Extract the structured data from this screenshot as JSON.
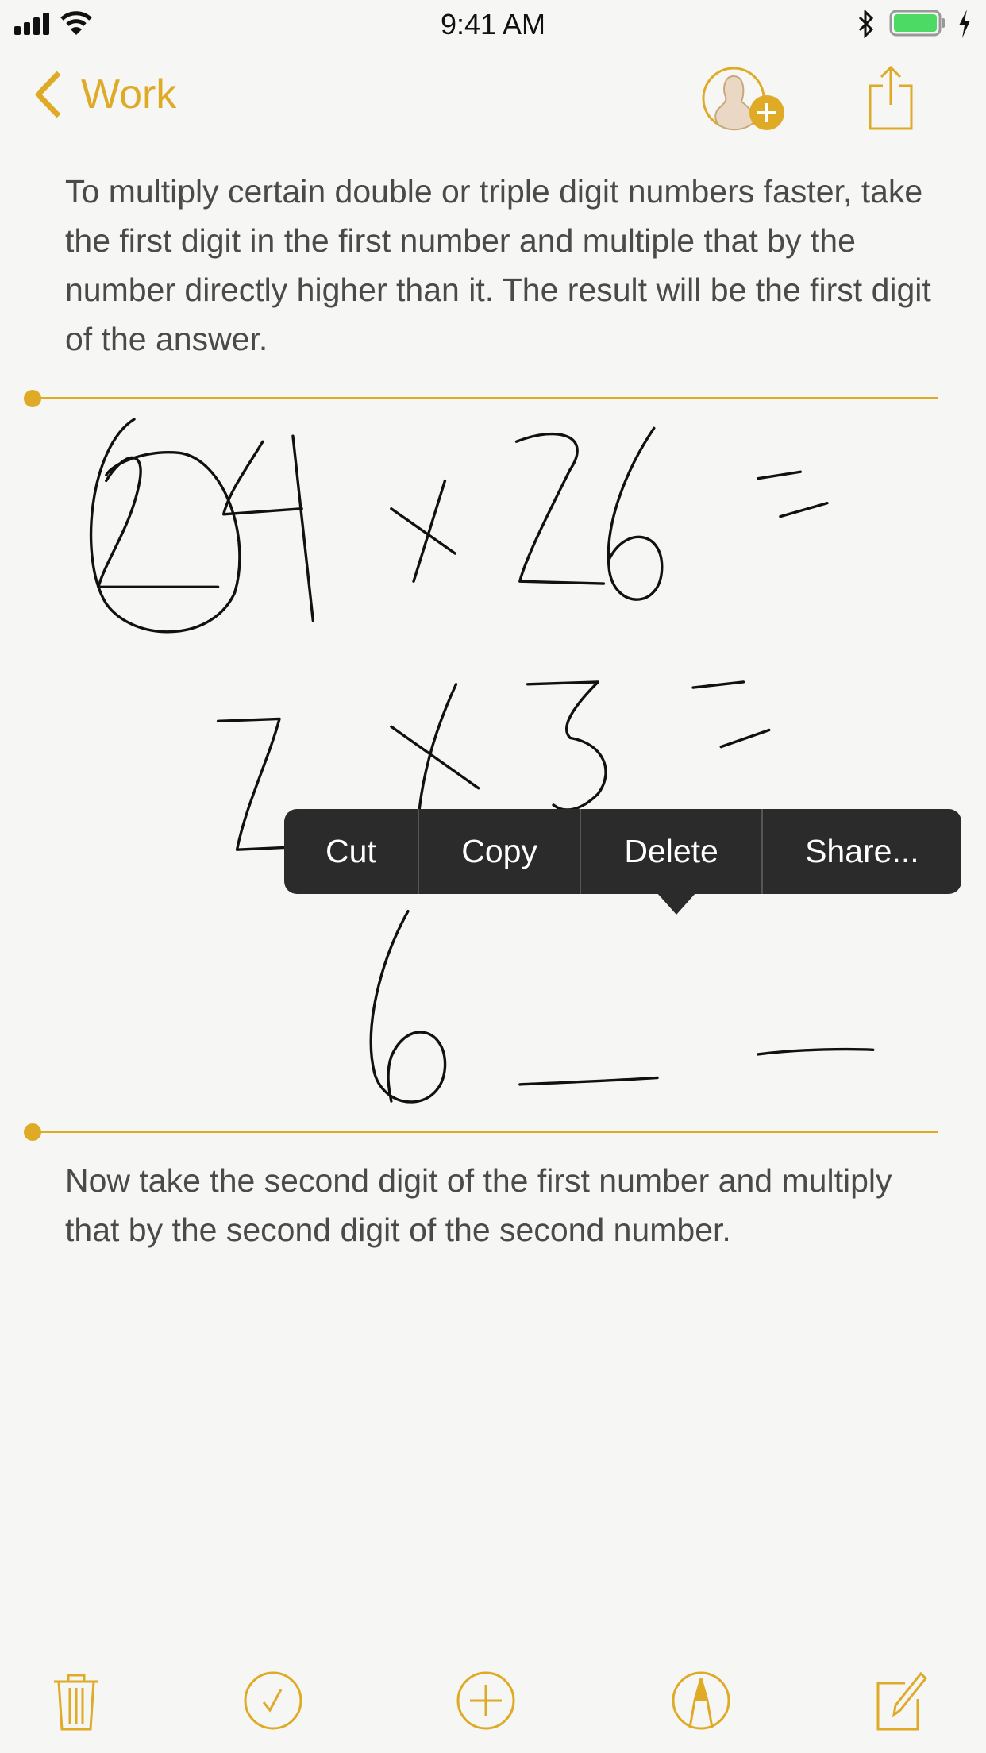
{
  "status_bar": {
    "time": "9:41 AM",
    "battery_color": "#4cd964"
  },
  "nav": {
    "back_label": "Work",
    "icons": [
      "chevron-left-icon",
      "add-person-icon",
      "share-icon"
    ]
  },
  "accent_color": "#dfaa26",
  "note": {
    "paragraph_1": "To multiply certain double or triple digit numbers faster, take the first digit in the first number and multiple that by the number directly higher than it. The result will be the first digit of the answer.",
    "drawing_strokes": "24 x 26 = / 2 x 3 = / 6 _ _",
    "paragraph_2": "Now take the second digit of the first number and multiply that by the second digit of the second number."
  },
  "context_menu": {
    "items": [
      "Cut",
      "Copy",
      "Delete",
      "Share..."
    ]
  },
  "toolbar": {
    "icons": [
      "trash-icon",
      "checklist-icon",
      "add-icon",
      "markup-icon",
      "compose-icon"
    ]
  }
}
